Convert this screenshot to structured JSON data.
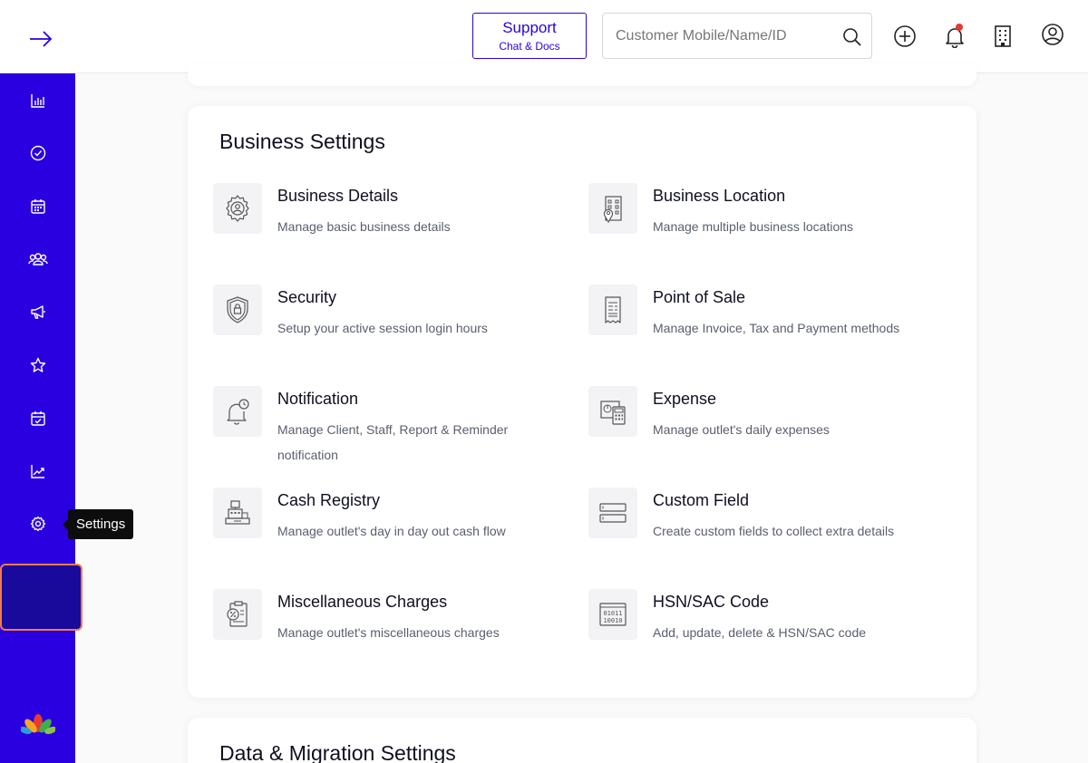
{
  "header": {
    "support_title": "Support",
    "support_sub": "Chat & Docs",
    "search_placeholder": "Customer Mobile/Name/ID"
  },
  "sidebar": {
    "items": [
      {
        "name": "reports",
        "icon": "bar-chart-icon"
      },
      {
        "name": "checkout",
        "icon": "check-circle-icon"
      },
      {
        "name": "calendar",
        "icon": "calendar-icon"
      },
      {
        "name": "clients",
        "icon": "users-icon"
      },
      {
        "name": "marketing",
        "icon": "megaphone-icon"
      },
      {
        "name": "loyalty",
        "icon": "star-icon"
      },
      {
        "name": "appointments",
        "icon": "calendar-check-icon"
      },
      {
        "name": "analytics",
        "icon": "trend-icon"
      },
      {
        "name": "settings",
        "icon": "gear-icon"
      }
    ],
    "tooltip": "Settings"
  },
  "business_settings": {
    "heading": "Business Settings",
    "items": [
      {
        "title": "Business Details",
        "desc": "Manage basic business details",
        "icon": "gear-user-icon"
      },
      {
        "title": "Business Location",
        "desc": "Manage multiple business locations",
        "icon": "building-location-icon"
      },
      {
        "title": "Security",
        "desc": "Setup your active session login hours",
        "icon": "shield-lock-icon"
      },
      {
        "title": "Point of Sale",
        "desc": "Manage Invoice, Tax and Payment methods",
        "icon": "receipt-icon"
      },
      {
        "title": "Notification",
        "desc": "Manage Client, Staff, Report & Reminder notification",
        "icon": "bell-clock-icon"
      },
      {
        "title": "Expense",
        "desc": "Manage outlet's daily expenses",
        "icon": "calculator-icon"
      },
      {
        "title": "Cash Registry",
        "desc": "Manage outlet's day in day out cash flow",
        "icon": "cash-register-icon"
      },
      {
        "title": "Custom Field",
        "desc": "Create custom fields to collect extra details",
        "icon": "form-fields-icon"
      },
      {
        "title": "Miscellaneous Charges",
        "desc": "Manage outlet's miscellaneous charges",
        "icon": "clipboard-percent-icon"
      },
      {
        "title": "HSN/SAC Code",
        "desc": "Add, update, delete & HSN/SAC code",
        "icon": "binary-code-icon"
      }
    ]
  },
  "data_migration": {
    "heading": "Data & Migration Settings"
  },
  "colors": {
    "sidebar": "#2a00e0",
    "active_outline": "#f47b48",
    "notification_dot": "#e53935"
  }
}
